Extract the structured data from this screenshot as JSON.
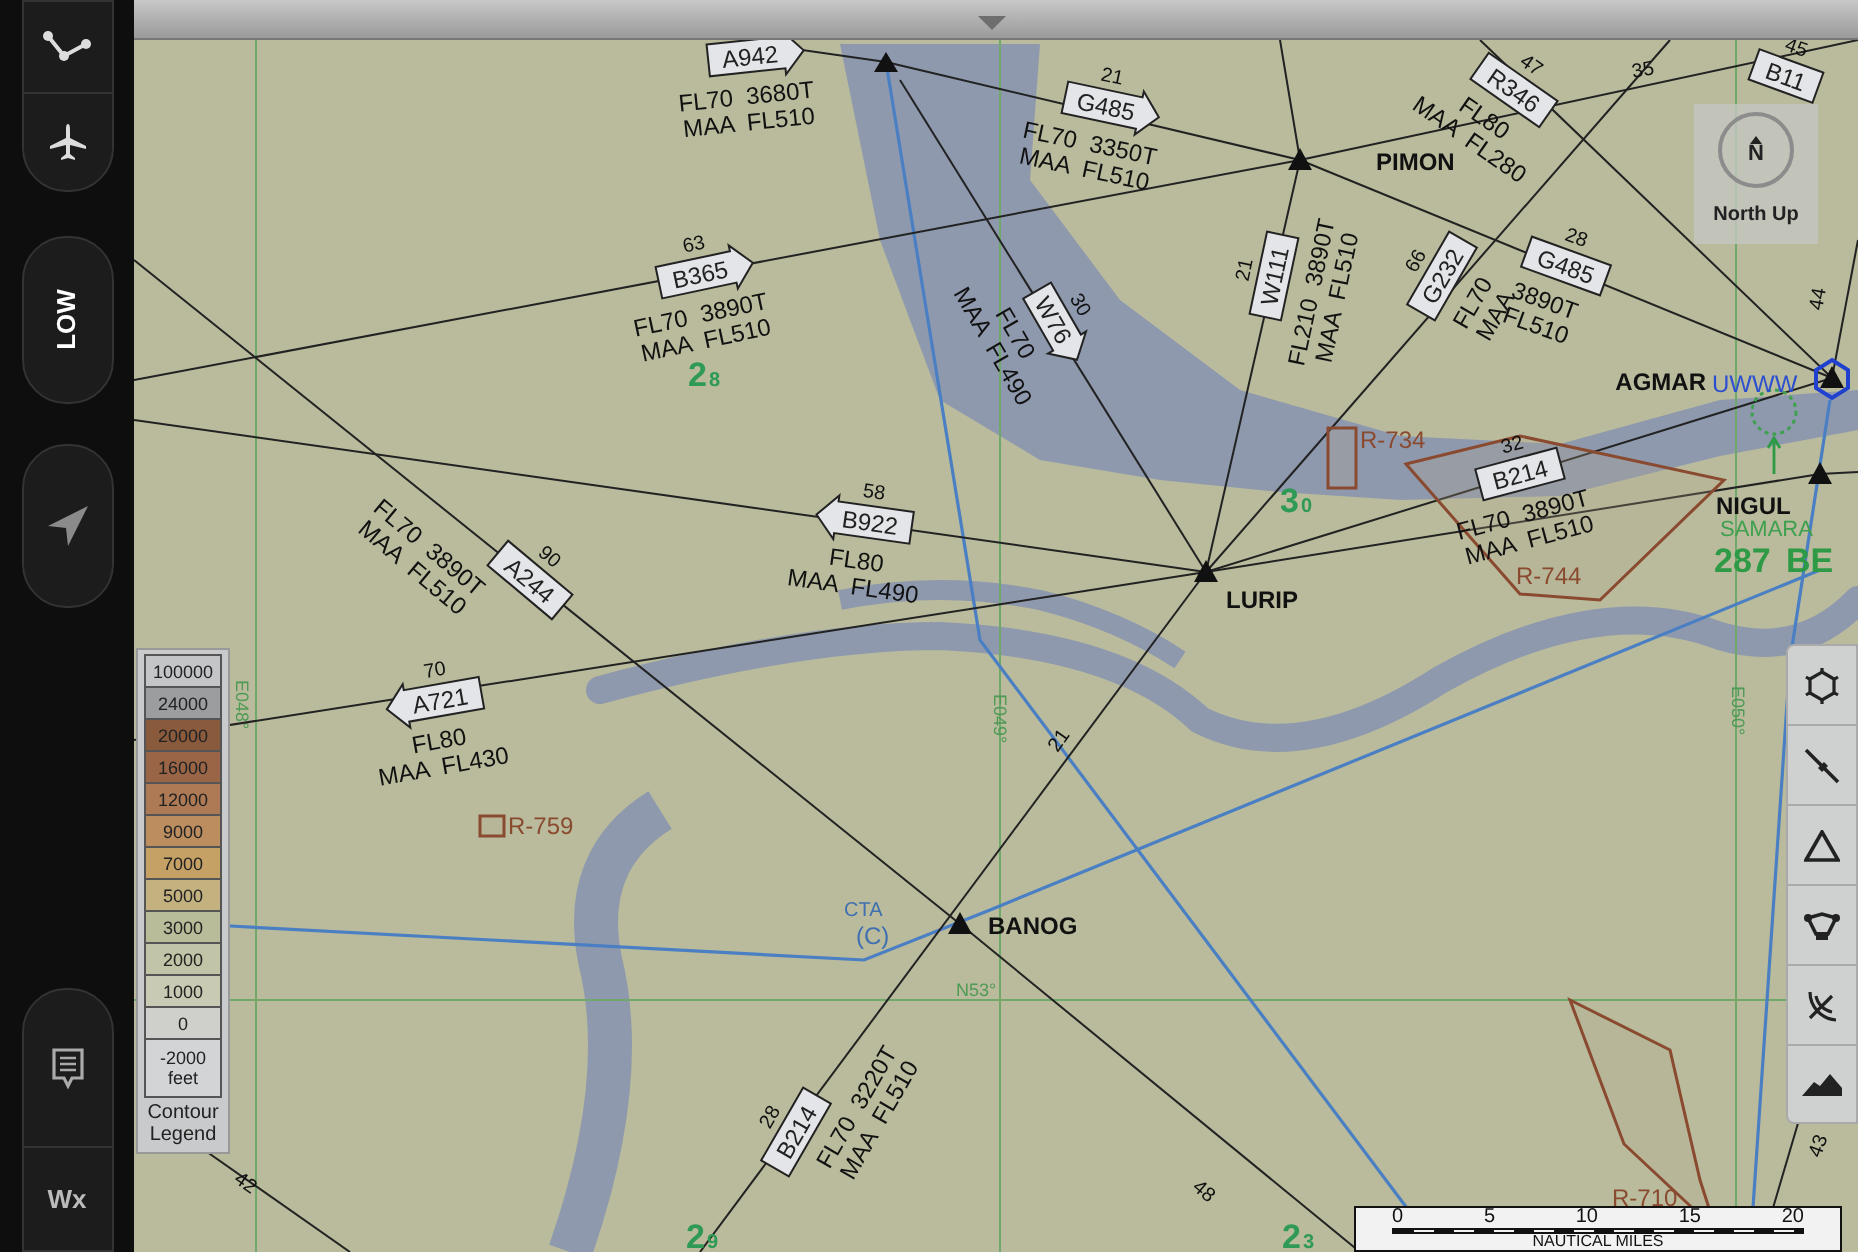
{
  "sidebar": {
    "chart_level": "LOW",
    "weather": "Wx"
  },
  "compass": {
    "north": "N",
    "label": "North Up"
  },
  "legend": {
    "steps": [
      {
        "label": "100000",
        "color": "#c4c5c7"
      },
      {
        "label": "24000",
        "color": "#9c9d9f"
      },
      {
        "label": "20000",
        "color": "#8a5a3c"
      },
      {
        "label": "16000",
        "color": "#9a6547"
      },
      {
        "label": "12000",
        "color": "#ad7a55"
      },
      {
        "label": "9000",
        "color": "#bb8d5f"
      },
      {
        "label": "7000",
        "color": "#c5a165"
      },
      {
        "label": "5000",
        "color": "#c3b27f"
      },
      {
        "label": "3000",
        "color": "#b9bc98"
      },
      {
        "label": "2000",
        "color": "#c1c4a6"
      },
      {
        "label": "1000",
        "color": "#c8cab3"
      },
      {
        "label": "0",
        "color": "#cfd0cb"
      },
      {
        "label": "-2000",
        "color": "#d3d4d6"
      }
    ],
    "unit": "feet",
    "title": "Contour Legend"
  },
  "waypoints": [
    {
      "name": "PIMON"
    },
    {
      "name": "LURIP"
    },
    {
      "name": "AGMAR"
    },
    {
      "name": "NIGUL"
    },
    {
      "name": "BANOG"
    }
  ],
  "airways": [
    {
      "ident": "A942",
      "altitudes": [
        "FL70  3680T",
        "MAA  FL510"
      ]
    },
    {
      "ident": "G485",
      "distance": "21",
      "altitudes": [
        "FL70  3350T",
        "MAA  FL510"
      ]
    },
    {
      "ident": "B365",
      "distance": "63",
      "altitudes": [
        "FL70  3890T",
        "MAA  FL510"
      ]
    },
    {
      "ident": "W76",
      "distance": "30",
      "altitudes": [
        "FL70",
        "MAA  FL490"
      ]
    },
    {
      "ident": "W111",
      "distance": "21",
      "altitudes": [
        "FL210  3890T",
        "MAA  FL510"
      ]
    },
    {
      "ident": "G232",
      "distance": "66",
      "altitudes": [
        "FL70",
        "MAA"
      ]
    },
    {
      "ident": "R346",
      "distance": "47",
      "altitudes": [
        "FL80",
        "MAA  FL280"
      ]
    },
    {
      "ident": "G485",
      "distance": "28",
      "altitudes": [
        "3890T",
        "FL510"
      ]
    },
    {
      "ident": "B214",
      "distance": "32",
      "altitudes": [
        "FL70  3890T",
        "MAA  FL510"
      ]
    },
    {
      "ident": "B922",
      "distance": "58",
      "altitudes": [
        "FL80",
        "MAA  FL490"
      ]
    },
    {
      "ident": "A244",
      "distance": "90",
      "altitudes": [
        "FL70  3890T",
        "MAA  FL510"
      ]
    },
    {
      "ident": "A721",
      "distance": "70",
      "altitudes": [
        "FL80",
        "MAA  FL430"
      ]
    },
    {
      "ident": "B214",
      "distance": "28",
      "altitudes": [
        "FL70  3220T",
        "MAA  FL510"
      ]
    },
    {
      "ident": "B11",
      "distance": "45"
    }
  ],
  "restricted_areas": [
    {
      "name": "R-734"
    },
    {
      "name": "R-744"
    },
    {
      "name": "R-759"
    },
    {
      "name": "R-710"
    }
  ],
  "grid_labels": [
    "E048°",
    "E049°",
    "E050°",
    "N53°"
  ],
  "grid_mora": [
    {
      "major": "2",
      "minor": "8"
    },
    {
      "major": "3",
      "minor": "0"
    },
    {
      "major": "2",
      "minor": "9"
    },
    {
      "major": "2",
      "minor": "3"
    }
  ],
  "segment_distances": [
    "35",
    "44",
    "42",
    "48",
    "21",
    "43"
  ],
  "airspace": {
    "name": "CTA",
    "class": "(C)"
  },
  "airport": {
    "city": "SAMARA",
    "code": "UWWW"
  },
  "ndb": {
    "frequency": "287",
    "ident": "BE"
  },
  "scale_bar": {
    "ticks": [
      "0",
      "5",
      "10",
      "15",
      "20"
    ],
    "unit": "NAUTICAL MILES"
  }
}
